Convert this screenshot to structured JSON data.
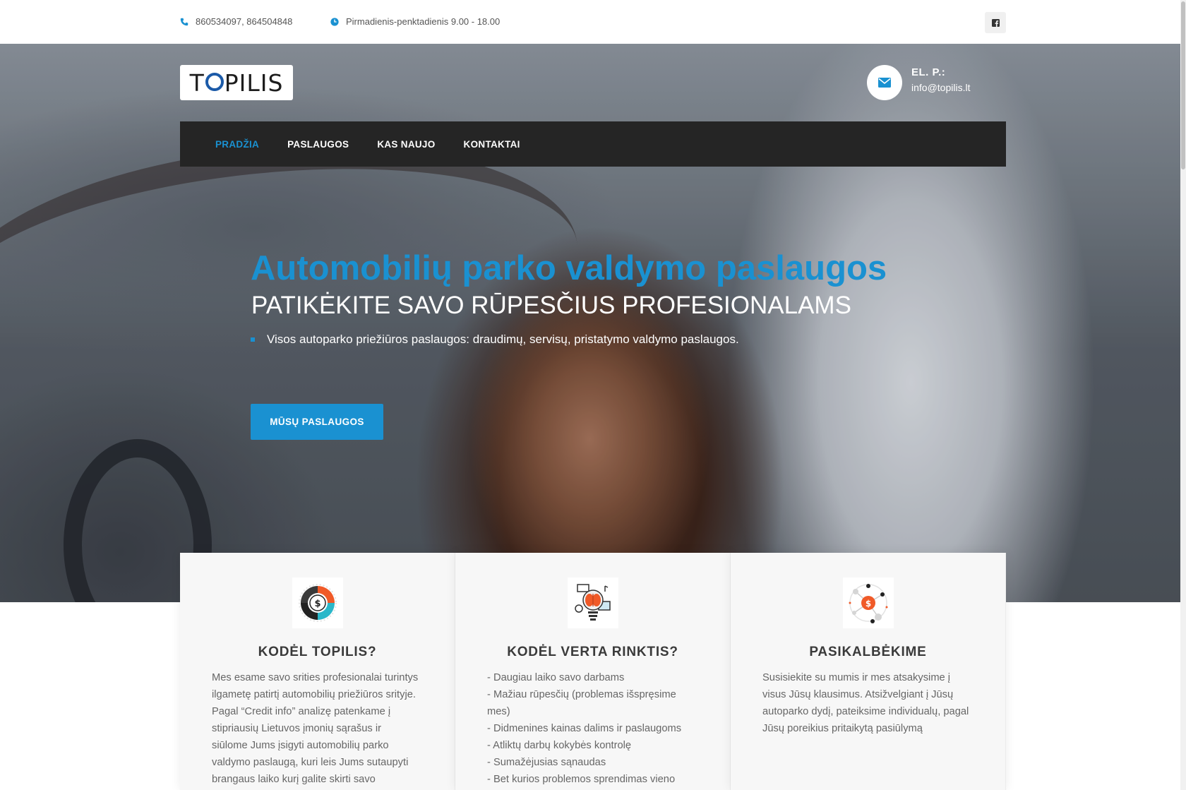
{
  "topbar": {
    "phone": "860534097, 864504848",
    "hours": "Pirmadienis-penktadienis 9.00 - 18.00",
    "phone_icon": "phone-icon",
    "clock_icon": "clock-icon",
    "social_icon": "facebook-icon"
  },
  "header": {
    "logo_text_before": "T",
    "logo_text_after": "PILIS",
    "email_label": "EL. P.:",
    "email_value": "info@topilis.lt",
    "email_icon": "envelope-icon"
  },
  "nav": {
    "items": [
      {
        "label": "PRADŽIA",
        "active": true
      },
      {
        "label": "PASLAUGOS",
        "active": false
      },
      {
        "label": "KAS NAUJO",
        "active": false
      },
      {
        "label": "KONTAKTAI",
        "active": false
      }
    ]
  },
  "hero": {
    "title": "Automobilių parko valdymo paslaugos",
    "subtitle": "PATIKĖKITE SAVO RŪPESČIUS PROFESIONALAMS",
    "bullet": "Visos autoparko priežiūros paslaugos: draudimų, servisų, pristatymo valdymo paslaugos.",
    "cta_label": "MŪSŲ PASLAUGOS"
  },
  "cards": [
    {
      "icon": "chart-dollar-icon",
      "title": "KODĖL TOPILIS?",
      "lines": [
        "Mes esame savo srities profesionalai turintys",
        "ilgametę patirtį automobilių priežiūros srityje.",
        "Pagal “Credit info” analizę patenkame į",
        "stipriausių Lietuvos įmonių sąrašus ir",
        "siūlome Jums įsigyti automobilių parko",
        "valdymo paslaugą, kuri leis Jums sutaupyti",
        "brangaus laiko kurį galite skirti savo"
      ]
    },
    {
      "icon": "brain-bulb-icon",
      "title": "KODĖL VERTA RINKTIS?",
      "lines": [
        "- Daugiau laiko savo darbams",
        "- Mažiau rūpesčių (problemas išspręsime",
        "mes)",
        "- Didmenines kainas dalims ir paslaugoms",
        "- Atliktų darbų kokybės kontrolę",
        "- Sumažėjusias sąnaudas",
        "- Bet kurios problemos sprendimas vieno"
      ]
    },
    {
      "icon": "network-dollar-icon",
      "title": "PASIKALBĖKIME",
      "lines": [
        "Susisiekite su mumis ir mes atsakysime į",
        "visus Jūsų klausimus. Atsižvelgiant į Jūsų",
        "autoparko dydį, pateiksime individualų, pagal",
        "Jūsų poreikius pritaikytą pasiūlymą"
      ]
    }
  ],
  "colors": {
    "accent": "#1a91d1",
    "nav_bg": "#252525",
    "card_bg": "#f7f7f7"
  }
}
